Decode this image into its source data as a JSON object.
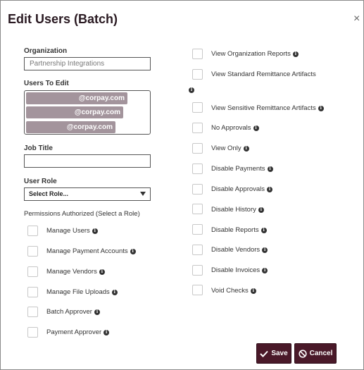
{
  "dialog": {
    "title": "Edit Users (Batch)",
    "close_glyph": "×"
  },
  "organization": {
    "label": "Organization",
    "value": "Partnership Integrations"
  },
  "users": {
    "label": "Users To Edit",
    "emails": [
      "@corpay.com",
      "@corpay.com",
      "@corpay.com"
    ]
  },
  "job_title": {
    "label": "Job Title",
    "value": ""
  },
  "user_role": {
    "label": "User Role",
    "selected": "Select Role..."
  },
  "permissions": {
    "heading": "Permissions Authorized (Select a Role)",
    "left": [
      {
        "label": "Manage Users",
        "checked": false
      },
      {
        "label": "Manage Payment Accounts",
        "checked": false
      },
      {
        "label": "Manage Vendors",
        "checked": false
      },
      {
        "label": "Manage File Uploads",
        "checked": false
      },
      {
        "label": "Batch Approver",
        "checked": false
      },
      {
        "label": "Payment Approver",
        "checked": false
      }
    ],
    "right": [
      {
        "label": "View Organization Reports",
        "checked": false
      },
      {
        "label": "View Standard Remittance Artifacts",
        "checked": false
      },
      {
        "label": "View Sensitive Remittance Artifacts",
        "checked": false
      },
      {
        "label": "No Approvals",
        "checked": false
      },
      {
        "label": "View Only",
        "checked": false
      },
      {
        "label": "Disable Payments",
        "checked": false
      },
      {
        "label": "Disable Approvals",
        "checked": false
      },
      {
        "label": "Disable History",
        "checked": false
      },
      {
        "label": "Disable Reports",
        "checked": false
      },
      {
        "label": "Disable Vendors",
        "checked": false
      },
      {
        "label": "Disable Invoices",
        "checked": false
      },
      {
        "label": "Void Checks",
        "checked": false
      }
    ]
  },
  "buttons": {
    "save": "Save",
    "cancel": "Cancel"
  },
  "colors": {
    "brand": "#4a1929",
    "chip": "#a3949c"
  },
  "icons": {
    "info": "info-icon",
    "close": "close-icon",
    "save": "check-icon",
    "cancel": "ban-icon"
  }
}
